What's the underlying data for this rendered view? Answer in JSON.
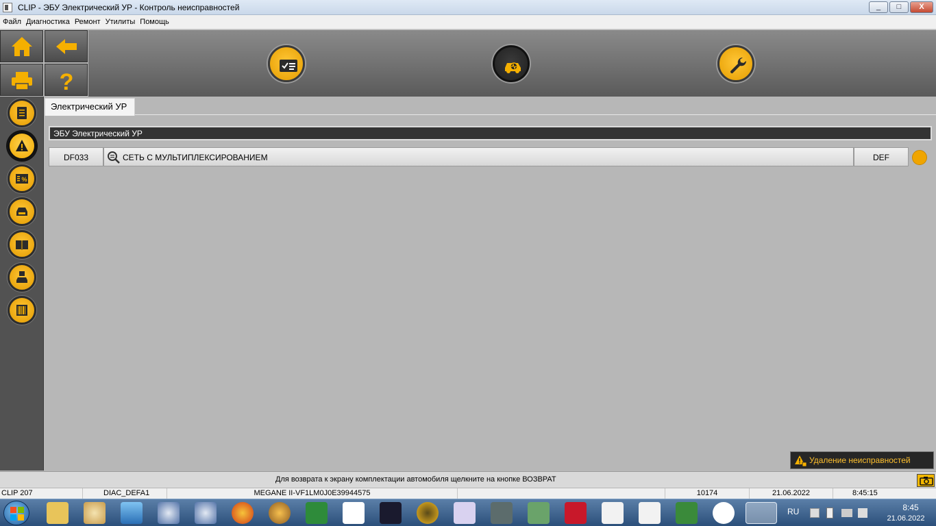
{
  "window": {
    "title": "CLIP - ЭБУ Электрический УР - Контроль неисправностей",
    "controls": {
      "minimize": "_",
      "maximize": "□",
      "close": "X"
    }
  },
  "menu": [
    "Файл",
    "Диагностика",
    "Ремонт",
    "Утилиты",
    "Помощь"
  ],
  "left_buttons": [
    {
      "name": "home",
      "icon": "home-icon"
    },
    {
      "name": "back",
      "icon": "arrow-left-icon"
    },
    {
      "name": "print",
      "icon": "printer-icon"
    },
    {
      "name": "help",
      "icon": "question-mark-icon"
    }
  ],
  "toolbar": [
    {
      "name": "checklist",
      "icon": "checklist-icon"
    },
    {
      "name": "vehicle-diagnostic",
      "icon": "car-diagnostic-icon",
      "active": true
    },
    {
      "name": "repair",
      "icon": "wrench-icon"
    }
  ],
  "sidebar": [
    {
      "name": "report",
      "icon": "document-icon"
    },
    {
      "name": "faults",
      "icon": "warning-icon",
      "active": true
    },
    {
      "name": "parameters",
      "icon": "percent-list-icon"
    },
    {
      "name": "status",
      "icon": "car-dashboard-icon"
    },
    {
      "name": "documentation",
      "icon": "book-icon"
    },
    {
      "name": "save-vehicle",
      "icon": "car-save-icon"
    },
    {
      "name": "barcode",
      "icon": "barcode-icon"
    }
  ],
  "tab": {
    "label": "Электрический УР"
  },
  "ecu_header": "ЭБУ Электрический УР",
  "fault": {
    "code": "DF033",
    "description": "СЕТЬ С МУЛЬТИПЛЕКСИРОВАНИЕМ",
    "state": "DEF",
    "status_color": "#f0a500"
  },
  "clear_faults_button": "Удаление неисправностей",
  "message": "Для возврата к экрану комплектации автомобиля щелкните на кнопке ВОЗВРАТ",
  "status_bar": {
    "device": "CLIP 207",
    "diag": "DIAC_DEFA1",
    "vehicle": "MEGANE II-VF1LM0J0E39944575",
    "counter": "10174",
    "date": "21.06.2022",
    "time": "8:45:15"
  },
  "taskbar": {
    "lang": "RU",
    "clock_time": "8:45",
    "clock_date": "21.06.2022",
    "apps": [
      "file-explorer-icon",
      "paint-icon",
      "monitor-icon",
      "diagnostic-tool-icon",
      "diagnostic-tool-icon",
      "no-entry-icon",
      "app-icon",
      "speed-limit-icon",
      "lightning-icon",
      "k-logo-icon",
      "gauge-icon",
      "hex-vag-icon",
      "chip-programmer-icon",
      "chip-icon",
      "mut-iii-icon",
      "mitsubishi-icon",
      "mitsubishi-icon",
      "circuit-board-icon",
      "yandex-browser-icon",
      "clip-icon"
    ]
  },
  "colors": {
    "accent": "#f5b000",
    "toolbar": "#6e6e6e",
    "sidebar": "#525252",
    "content": "#b7b7b7"
  }
}
